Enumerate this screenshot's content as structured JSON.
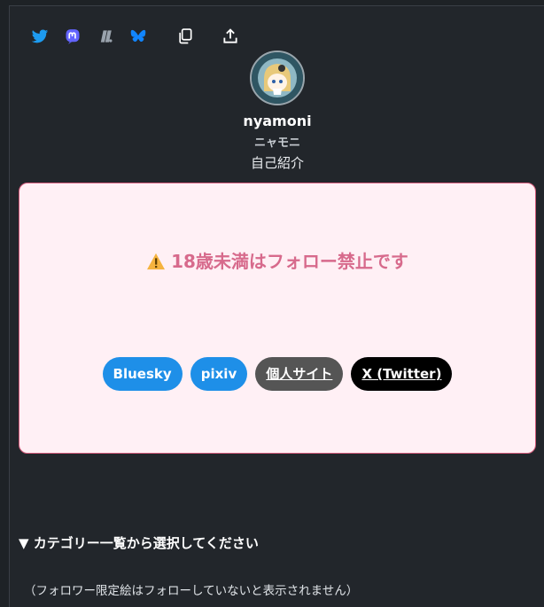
{
  "toolbar": {
    "icons": [
      "twitter-icon",
      "mastodon-icon",
      "misskey-icon",
      "bluesky-icon",
      "copy-icon",
      "share-icon"
    ]
  },
  "profile": {
    "name": "nyamoni",
    "kana": "ニャモニ",
    "bio": "自己紹介"
  },
  "notice": {
    "warning": "18歳未満はフォロー禁止です",
    "links": [
      "Bluesky",
      "pixiv",
      "個人サイト",
      "X (Twitter)"
    ]
  },
  "category": {
    "label": "▼ カテゴリー一覧から選択してください"
  },
  "note": "（フォロワー限定絵はフォローしていないと表示されません）",
  "colors": {
    "background": "#22262b",
    "notice_bg": "#fff0f5",
    "notice_border": "#d25a7a",
    "warning_text": "#d76a8c",
    "pill_blue": "#1e8fe8",
    "pill_gray": "#555555",
    "pill_black": "#000000"
  }
}
